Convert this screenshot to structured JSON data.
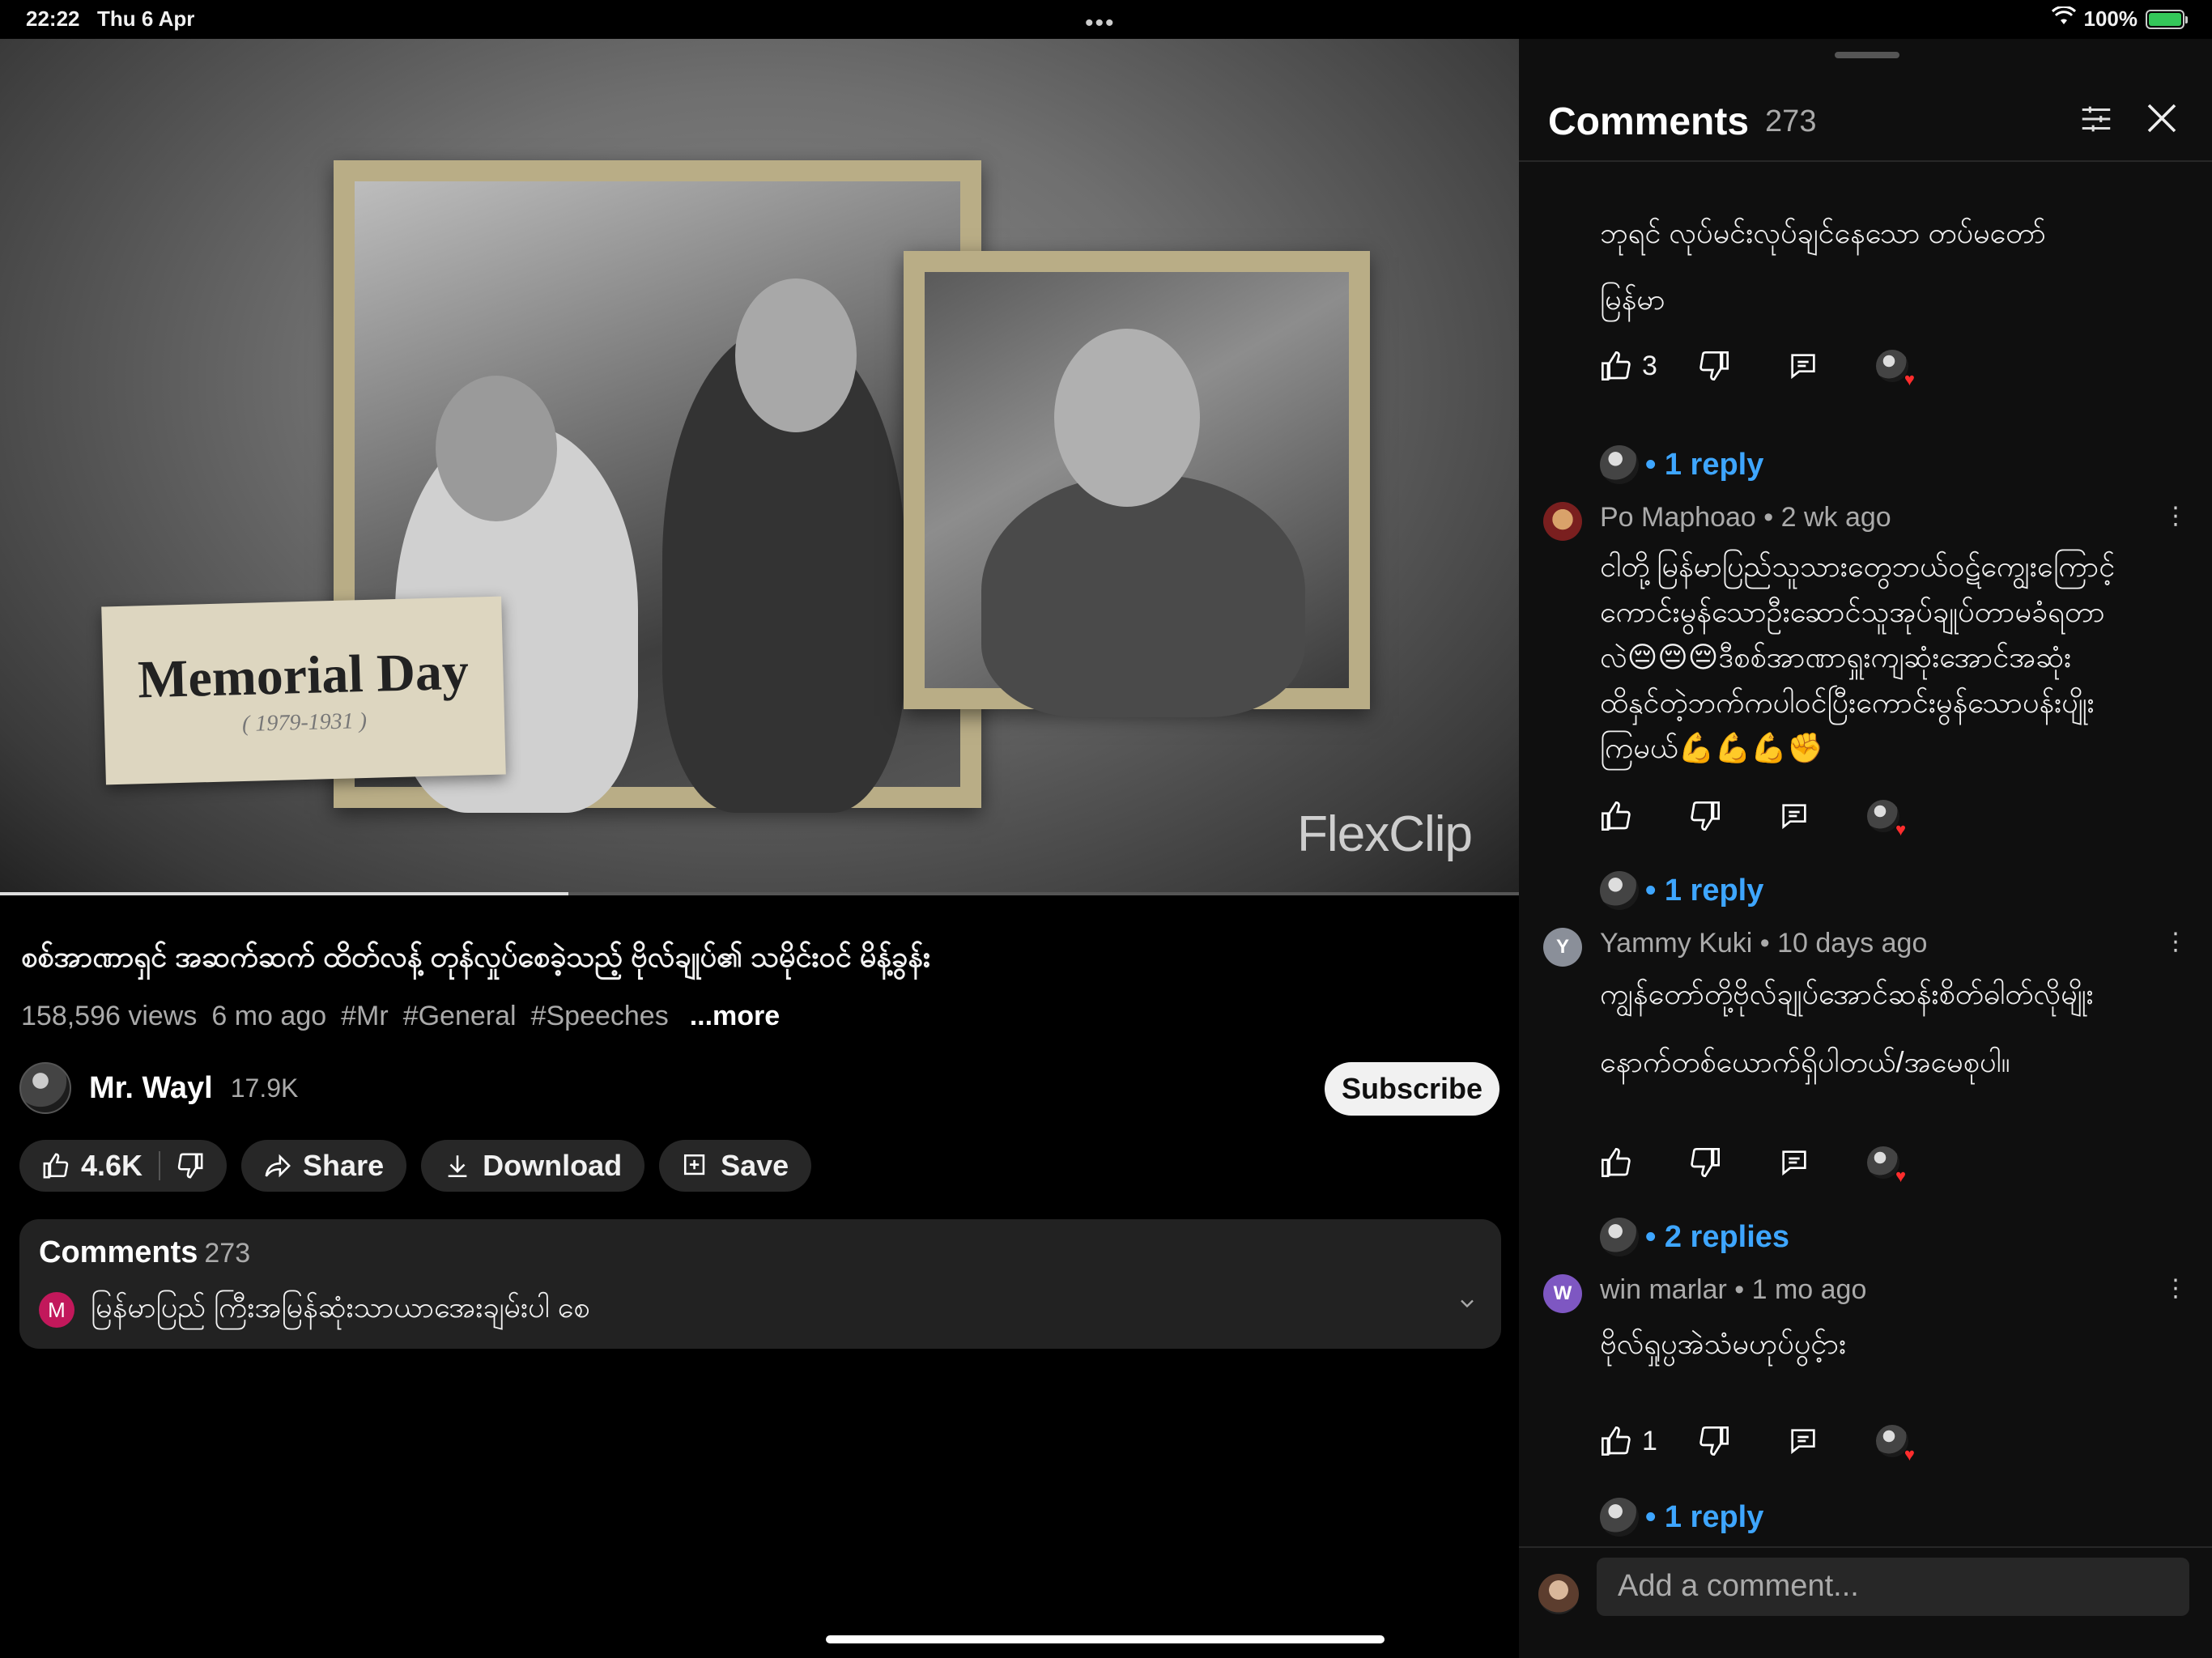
{
  "status_bar": {
    "time": "22:22",
    "date": "Thu 6 Apr",
    "battery": "100%"
  },
  "video": {
    "overlay_title": "Memorial Day",
    "overlay_years": "( 1979-1931 )",
    "watermark": "FlexClip",
    "progress_fraction": 0.374
  },
  "info": {
    "title": "စစ်အာဏာရှင် အဆက်ဆက် ထိတ်လန့် တုန်လှုပ်စေခဲ့သည့် ဗိုလ်ချုပ်၏ သမိုင်းဝင် မိန့်ခွန်း",
    "views": "158,596 views",
    "age": "6 mo ago",
    "tags": [
      "#Mr",
      "#General",
      "#Speeches"
    ],
    "more": "...more",
    "channel_name": "Mr. Wayl",
    "channel_subs": "17.9K",
    "subscribe": "Subscribe",
    "likes": "4.6K",
    "share": "Share",
    "download": "Download",
    "save": "Save"
  },
  "comments_card": {
    "label": "Comments",
    "count": "273",
    "avatar_letter": "M",
    "preview": "မြန်မာပြည် ကြီးအမြန်ဆုံးသာယာအေးချမ်းပါ စေ"
  },
  "panel": {
    "title": "Comments",
    "count": "273",
    "comments": [
      {
        "user": "",
        "text_lines": [
          "ဘုရင် လုပ်မင်းလုပ်ချင်နေသော တပ်မတော်",
          "မြန်မာ"
        ],
        "likes": "3",
        "replies": "• 1 reply"
      },
      {
        "user": "Po Maphoao • 2 wk ago",
        "text_lines": [
          "ငါတို့မြန်မာပြည်သူသားတွေဘယ်ဝဋ်ကျွေးကြောင့်",
          "ကောင်းမွန်သောဦးဆောင်သူအုပ်ချုပ်တာမခံရတာ",
          "လဲ😔😔😔ဒီစစ်အာဏာရှူးကျဆုံးအောင်အဆုံး",
          "ထိနှင်တဲ့ဘက်ကပါဝင်ပြီးကောင်းမွန်သောပန်းပျိုး",
          "ကြမယ်💪💪💪✊"
        ],
        "likes": "",
        "replies": "• 1 reply"
      },
      {
        "user": "Yammy Kuki • 10 days ago",
        "avatar_letter": "Y",
        "text_lines": [
          "ကျွန်တော်တို့ဗိုလ်ချုပ်အောင်ဆန်းစိတ်ဓါတ်လိုမျိုး",
          "နောက်တစ်ယောက်ရှိပါတယ်/အမေစုပါ။"
        ],
        "likes": "",
        "replies": "• 2 replies"
      },
      {
        "user": "win marlar • 1 mo ago",
        "avatar_letter": "W",
        "text_lines": [
          "ဗိုလ်ရှုပ္ပအဲသံမဟုပ်ပွင့်ား"
        ],
        "likes": "1",
        "replies": "• 1 reply"
      }
    ],
    "add_placeholder": "Add a comment..."
  },
  "colors": {
    "link": "#3ea6ff",
    "heart": "#ff2d2d",
    "card": "#222222"
  }
}
